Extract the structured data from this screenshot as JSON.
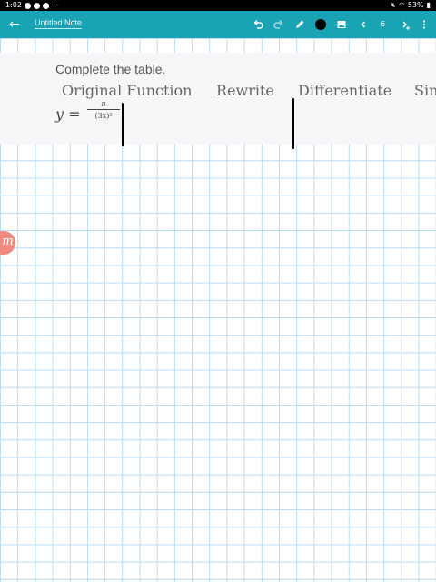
{
  "status_bar": {
    "time": "1:02",
    "more": "⋯",
    "battery": "53%"
  },
  "toolbar": {
    "title": "Untitled Note",
    "page_number": "6",
    "pen_color": "#000000",
    "accent": "#1aa3b3"
  },
  "note": {
    "prompt": "Complete the table.",
    "columns": [
      "Original Function",
      "Rewrite",
      "Differentiate",
      "Sin"
    ],
    "formula": {
      "lhs": "y =",
      "numerator": "π",
      "denominator": "(3x)²"
    }
  },
  "side_logo": "m"
}
